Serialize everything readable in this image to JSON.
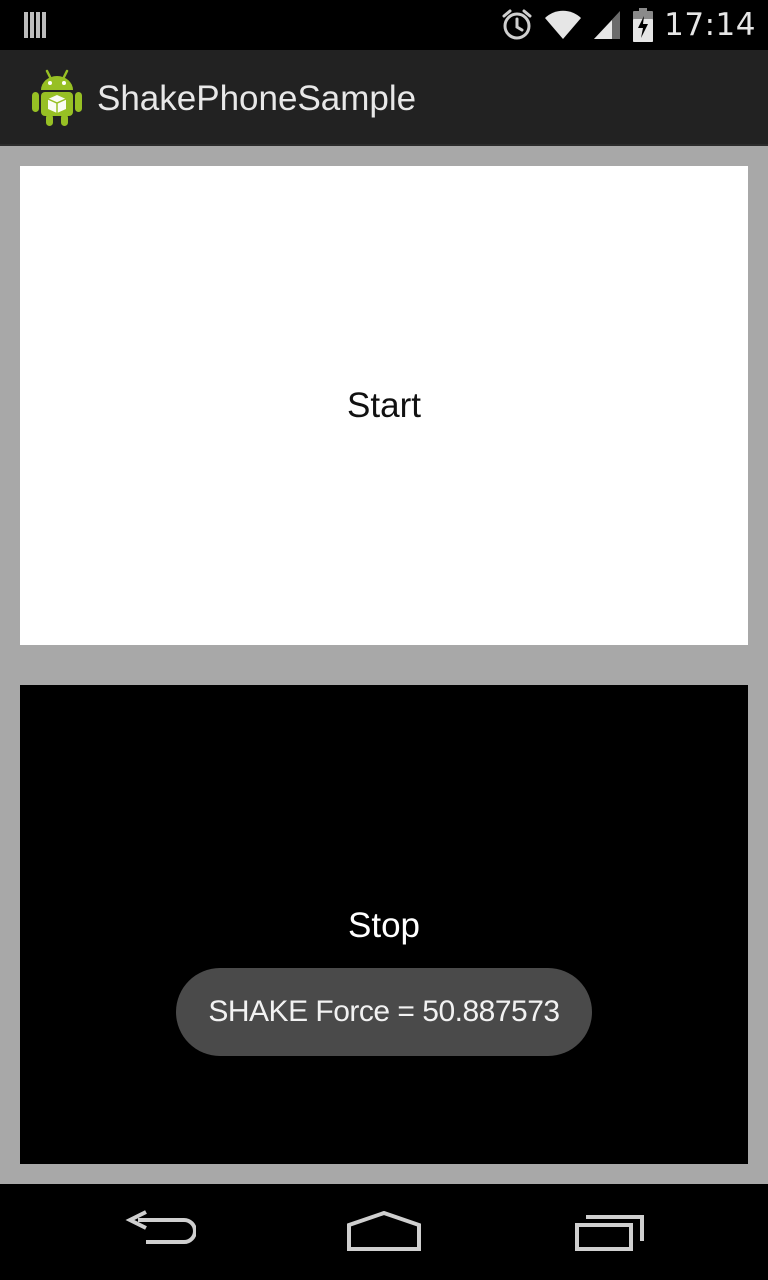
{
  "status_bar": {
    "time": "17:14",
    "icons": [
      "notification-bars-icon",
      "alarm-icon",
      "wifi-icon",
      "signal-icon",
      "battery-charging-icon"
    ]
  },
  "action_bar": {
    "app_icon": "android-app-icon",
    "title": "ShakePhoneSample"
  },
  "content": {
    "start_button": {
      "label": "Start"
    },
    "stop_button": {
      "label": "Stop"
    }
  },
  "toast": {
    "text": "SHAKE Force = 50.887573"
  },
  "nav_bar": {
    "icons": [
      "back-icon",
      "home-icon",
      "recents-icon"
    ]
  },
  "colors": {
    "status_bar_bg": "#000000",
    "action_bar_bg": "#222222",
    "content_bg": "#a8a8a8",
    "start_panel_bg": "#ffffff",
    "stop_panel_bg": "#000000",
    "toast_bg": "#4a4a4a",
    "android_green": "#97c024"
  }
}
